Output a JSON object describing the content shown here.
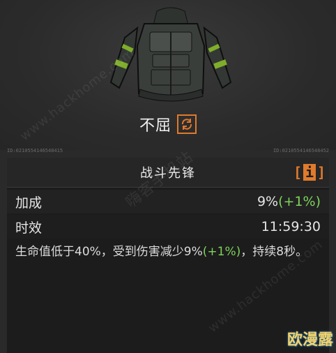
{
  "item": {
    "name": "不屈",
    "icon": "swap-cycle-icon",
    "serial_left": "ID:0210554146548415",
    "serial_right": "ID:0210554146548452"
  },
  "section": {
    "title": "战斗先锋",
    "info_icon": "info-bracket-icon"
  },
  "stats": [
    {
      "label": "加成",
      "value": "9%",
      "bonus": "(+1%)"
    },
    {
      "label": "时效",
      "value": "11:59:30",
      "bonus": ""
    }
  ],
  "description": {
    "part1": "生命值低于40%，受到伤害减少9%",
    "bonus": "(+1%)",
    "part2": "，持续8秒。"
  },
  "watermark": {
    "text1": "www.hackhome.com",
    "text2": "嗨客手机站",
    "logo": "欧漫露"
  },
  "colors": {
    "accent": "#e07a2c",
    "positive": "#7fd35b",
    "panel": "#1c1c1c"
  }
}
